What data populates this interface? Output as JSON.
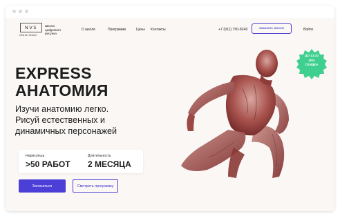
{
  "logo": {
    "mark": "NVS",
    "name": "New Art School"
  },
  "school": {
    "line1": "Школа",
    "line2": "цифрового",
    "line3": "рисунка"
  },
  "nav": {
    "items": [
      "О школе",
      "Программа",
      "Цены",
      "Контакты"
    ]
  },
  "phone": "+7 (911) 750-8240",
  "call_button": "Заказать звонок",
  "login": "Войти",
  "hero": {
    "title_line1": "EXPRESS",
    "title_line2": "АНАТОМИЯ",
    "subtitle_line1": "Изучи анатомию легко.",
    "subtitle_line2": "Рисуй естественных и",
    "subtitle_line3": "динамичных персонажей"
  },
  "stats": [
    {
      "label": "Нарисуешь",
      "value": ">50 РАБОТ"
    },
    {
      "label": "Длительность",
      "value": "2 МЕСЯЦА"
    }
  ],
  "buttons": {
    "primary": "Записаться",
    "secondary": "Смотреть программу"
  },
  "badge": {
    "line1": "ДО 13.10",
    "line2": "30%",
    "line3": "СКИДКА"
  },
  "colors": {
    "accent": "#4b3fd8",
    "badge": "#3fcf8e",
    "figure": "#8c3a3a",
    "background": "#faf7f5"
  }
}
